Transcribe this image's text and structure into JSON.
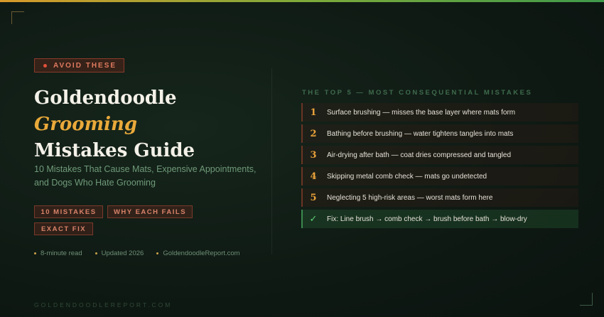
{
  "badge": {
    "label": "AVOID THESE"
  },
  "title": {
    "line1": "Goldendoodle",
    "line2": "Grooming",
    "line3": "Mistakes Guide"
  },
  "subtitle": {
    "line1": "10 Mistakes That Cause Mats, Expensive Appointments,",
    "line2": "and Dogs Who Hate Grooming"
  },
  "tags": [
    "10 MISTAKES",
    "WHY EACH FAILS",
    "EXACT FIX"
  ],
  "meta": [
    "8-minute read",
    "Updated 2026",
    "GoldendoodleReport.com"
  ],
  "footer": {
    "text": "GOLDENDOODLEREPORT.COM"
  },
  "list": {
    "heading": "THE TOP 5 — MOST CONSEQUENTIAL MISTAKES",
    "items": [
      {
        "num": "1",
        "text": "Surface brushing — misses the base layer where mats form"
      },
      {
        "num": "2",
        "text": "Bathing before brushing — water tightens tangles into mats"
      },
      {
        "num": "3",
        "text": "Air-drying after bath — coat dries compressed and tangled"
      },
      {
        "num": "4",
        "text": "Skipping metal comb check — mats go undetected"
      },
      {
        "num": "5",
        "text": "Neglecting 5 high-risk areas — worst mats form here"
      }
    ],
    "fix": {
      "mark": "✓",
      "text": "Fix: Line brush → comb check → brush before bath → blow-dry"
    }
  },
  "colors": {
    "accent_gold": "#e9a93a",
    "accent_red": "#e07a5f",
    "accent_green": "#5fcf78",
    "background": "#0f1a14"
  }
}
